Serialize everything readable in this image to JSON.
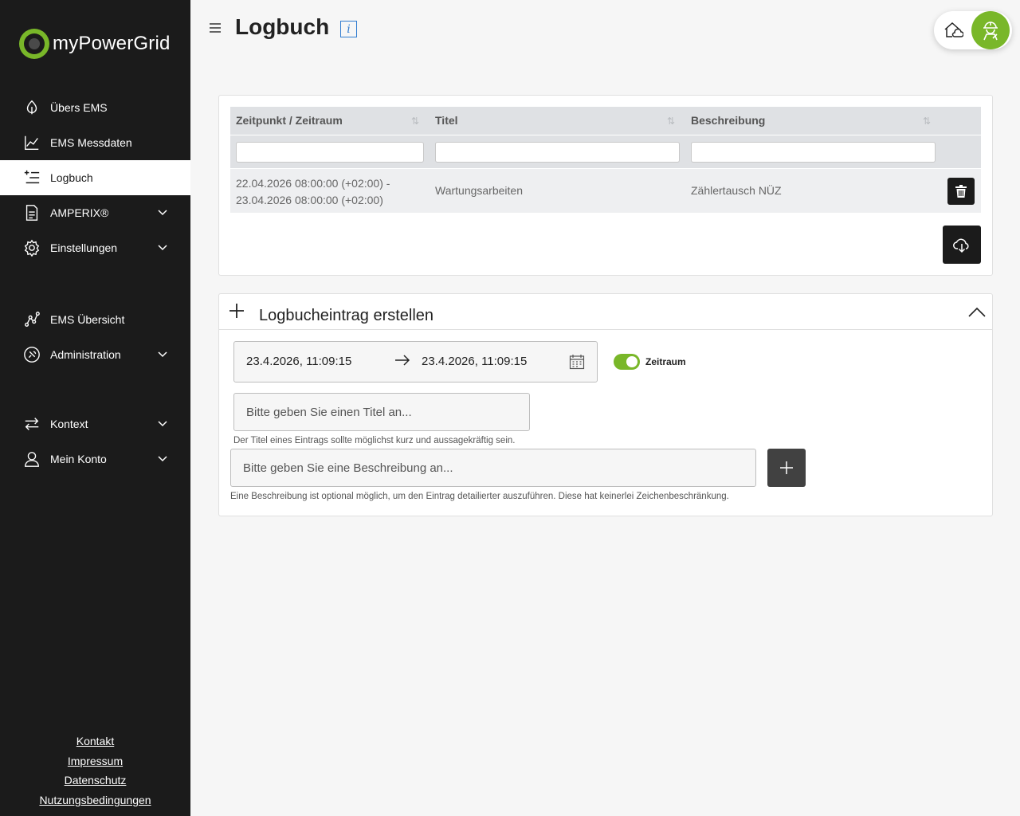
{
  "brand": {
    "name": "myPowerGrid",
    "accent": "#79b729"
  },
  "sidebar": {
    "items": [
      {
        "label": "Übers EMS",
        "icon": "leaf-icon"
      },
      {
        "label": "EMS Messdaten",
        "icon": "line-chart-icon"
      },
      {
        "label": "Logbuch",
        "icon": "list-add-icon",
        "active": true
      },
      {
        "label": "AMPERIX®",
        "icon": "document-icon",
        "expandable": true
      },
      {
        "label": "Einstellungen",
        "icon": "gear-icon",
        "expandable": true
      },
      {
        "label": "EMS Übersicht",
        "icon": "network-icon"
      },
      {
        "label": "Administration",
        "icon": "admin-icon",
        "expandable": true
      },
      {
        "label": "Kontext",
        "icon": "swap-arrows-icon",
        "expandable": true
      },
      {
        "label": "Mein Konto",
        "icon": "user-icon",
        "expandable": true
      }
    ],
    "footer": [
      "Kontakt",
      "Impressum",
      "Datenschutz",
      "Nutzungsbedingungen"
    ]
  },
  "header": {
    "title": "Logbuch",
    "info_icon": "i"
  },
  "table": {
    "columns": [
      "Zeitpunkt / Zeitraum",
      "Titel",
      "Beschreibung"
    ],
    "rows": [
      {
        "zeitraum_line1": "22.04.2026 08:00:00 (+02:00) -",
        "zeitraum_line2": "23.04.2026 08:00:00 (+02:00)",
        "titel": "Wartungsarbeiten",
        "beschreibung": "Zählertausch NÜZ"
      }
    ]
  },
  "create": {
    "title": "Logbucheintrag erstellen",
    "date_from": "23.4.2026, 11:09:15",
    "date_to": "23.4.2026, 11:09:15",
    "toggle_label": "Zeitraum",
    "toggle_on": true,
    "title_placeholder": "Bitte geben Sie einen Titel an...",
    "title_hint": "Der Titel eines Eintrags sollte möglichst kurz und aussagekräftig sein.",
    "desc_placeholder": "Bitte geben Sie eine Beschreibung an...",
    "desc_hint": "Eine Beschreibung ist optional möglich, um den Eintrag detailierter auszuführen. Diese hat keinerlei Zeichenbeschränkung."
  }
}
